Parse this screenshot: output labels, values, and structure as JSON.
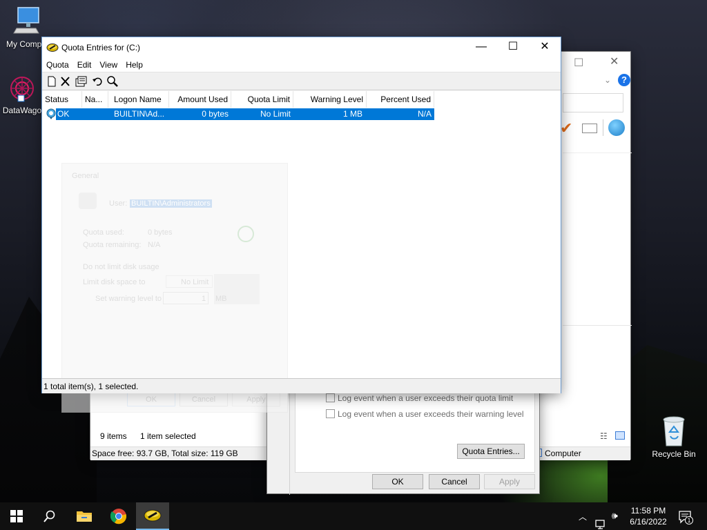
{
  "desktop": {
    "icons": [
      {
        "label": "My Compu",
        "icon": "computer-icon"
      },
      {
        "label": "DataWago",
        "icon": "datawago-icon"
      },
      {
        "label": "Recycle Bin",
        "icon": "recycle-bin-icon"
      }
    ]
  },
  "explorer": {
    "status_items": "9 items",
    "status_selected": "1 item selected",
    "space_info": "Space free: 93.7 GB, Total size: 119 GB",
    "location": "Computer"
  },
  "properties": {
    "check_quota_limit": "Log event when a user exceeds their quota limit",
    "check_warning_level": "Log event when a user exceeds their warning level",
    "quota_entries_button": "Quota Entries...",
    "ok": "OK",
    "cancel": "Cancel",
    "apply": "Apply"
  },
  "quota": {
    "title": "Quota Entries for  (C:)",
    "menu": [
      "Quota",
      "Edit",
      "View",
      "Help"
    ],
    "toolbar": [
      "new-entry-icon",
      "delete-icon",
      "properties-icon",
      "undo-icon",
      "find-icon"
    ],
    "columns": [
      "Status",
      "Na...",
      "Logon Name",
      "Amount Used",
      "Quota Limit",
      "Warning Level",
      "Percent Used"
    ],
    "rows": [
      {
        "status": "OK",
        "name": "",
        "logon": "BUILTIN\\Ad...",
        "amount": "0 bytes",
        "limit": "No Limit",
        "warning": "1 MB",
        "percent": "N/A"
      }
    ],
    "statusbar": "1 total item(s), 1 selected.",
    "ghost": {
      "group": "General",
      "user_label": "User:",
      "user_value": "BUILTIN\\Administrators",
      "quota_used_label": "Quota used:",
      "quota_used_value": "0 bytes",
      "quota_remaining_label": "Quota remaining:",
      "quota_remaining_value": "N/A",
      "radio_no_limit": "Do not limit disk usage",
      "radio_limit": "Limit disk space to",
      "limit_value": "No Limit",
      "warning_label": "Set warning level to",
      "warning_value": "1",
      "warning_unit": "MB",
      "ok": "OK",
      "cancel": "Cancel",
      "apply": "Apply"
    }
  },
  "taskbar": {
    "apps": [
      "file-explorer-icon",
      "chrome-icon",
      "quota-app-icon"
    ],
    "time": "11:58 PM",
    "date": "6/16/2022",
    "notification_count": "1"
  }
}
